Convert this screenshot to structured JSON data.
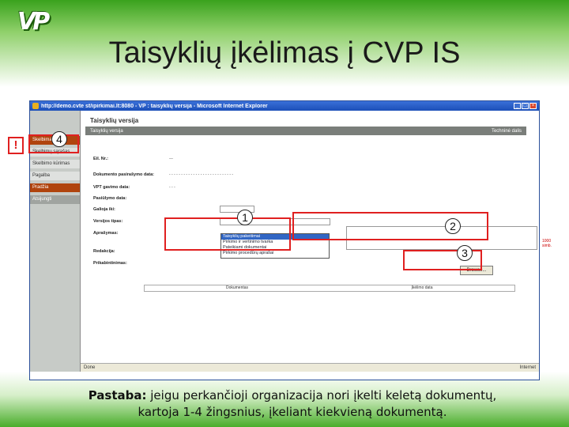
{
  "slide": {
    "logo_text": "VP",
    "title": "Taisyklių įkėlimas į CVP IS",
    "note_label": "Pastaba:",
    "note_line1": "jeigu perkančioji organizacija nori įkelti keletą dokumentų,",
    "note_line2": "kartoja 1-4 žingsnius, įkeliant kiekvieną dokumentą."
  },
  "browser": {
    "title": "http://demo.cvte st/ipirkimai.lt:8080 - VP : taisyklių versija - Microsoft Internet Explorer",
    "status_left": "Done",
    "status_right": "Internet"
  },
  "sidebar": {
    "items": [
      {
        "label": "Skelbimai",
        "state": "active"
      },
      {
        "label": "Skelbimų sąrašas",
        "state": "normal"
      },
      {
        "label": "Skelbimo kūrimas",
        "state": "normal"
      },
      {
        "label": "Pagalba",
        "state": "normal"
      },
      {
        "label": "Pradžia",
        "state": "active"
      },
      {
        "label": "Atsijungti",
        "state": "dark"
      }
    ]
  },
  "page": {
    "header": "Taisyklių versija",
    "tab_left": "Taisyklių versija",
    "tab_right": "Techninė dalis",
    "fields": [
      {
        "label": "Eil. Nr.:",
        "value": "---"
      },
      {
        "label": "Dokumento pasirašymo data:",
        "value": "- - - - - - - - - - - - - - - - - - - - - - - - - - -"
      },
      {
        "label": "VPT gavimo data:",
        "value": "- - -"
      },
      {
        "label": "Pasiūlymo data:",
        "value": ""
      },
      {
        "label": "Galioja iki:",
        "value": ""
      },
      {
        "label": "Versijos tipas:",
        "value": ""
      },
      {
        "label": "Aprašymas:",
        "value": ""
      },
      {
        "label": "Redakcija:",
        "value": ""
      },
      {
        "label": "Prikabintinimas:",
        "value": ""
      }
    ],
    "dropdown_options": [
      "Taisyklių pakeitimai",
      "Pirkimo ir vertinimo tvarka",
      "Pateikiami dokumentai",
      "Pirkimo procedūrų aprašai"
    ],
    "limit_text": "1000 simb.",
    "browse_label": "Browse...",
    "table_col1": "Dokumentas",
    "table_col2": "Įkėlimo data"
  },
  "callouts": {
    "alert": "!",
    "step1": "1",
    "step2": "2",
    "step3": "3",
    "step4": "4",
    "color": "#e02020"
  }
}
